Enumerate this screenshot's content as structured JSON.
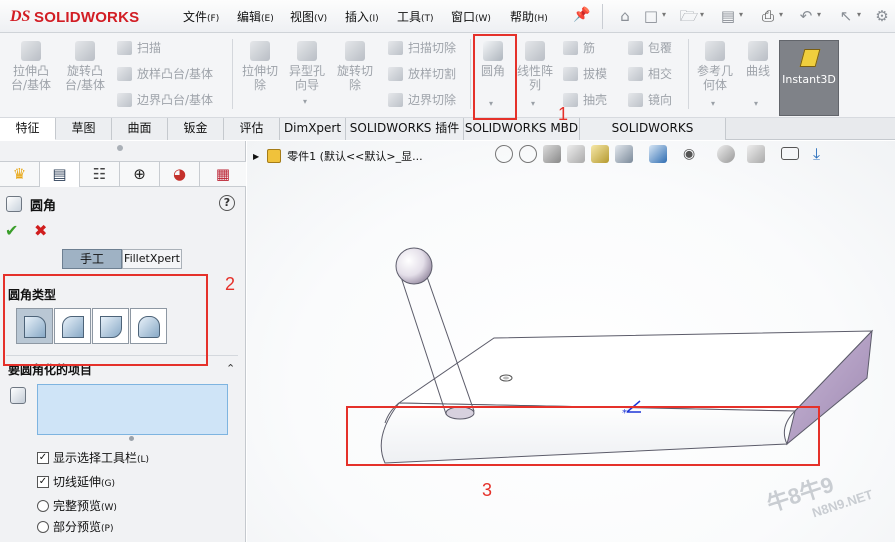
{
  "app": {
    "brand": "SOLIDWORKS",
    "logo_mark": "DS"
  },
  "menu": [
    {
      "label": "文件",
      "key": "(F)"
    },
    {
      "label": "编辑",
      "key": "(E)"
    },
    {
      "label": "视图",
      "key": "(V)"
    },
    {
      "label": "插入",
      "key": "(I)"
    },
    {
      "label": "工具",
      "key": "(T)"
    },
    {
      "label": "窗口",
      "key": "(W)"
    },
    {
      "label": "帮助",
      "key": "(H)"
    }
  ],
  "ribbon": {
    "extrude_boss": "拉伸凸\n台/基体",
    "revolve_boss": "旋转凸\n台/基体",
    "sweep": "扫描",
    "loft_boss": "放样凸台/基体",
    "boundary_boss": "边界凸台/基体",
    "extrude_cut": "拉伸切\n除",
    "hole_wizard": "异型孔\n向导",
    "revolve_cut": "旋转切\n除",
    "swept_cut": "扫描切除",
    "lofted_cut": "放样切割",
    "boundary_cut": "边界切除",
    "fillet": "圆角",
    "linear_pattern": "线性阵\n列",
    "rib": "筋",
    "draft": "拔模",
    "shell": "抽壳",
    "wrap": "包覆",
    "intersect": "相交",
    "mirror": "镜向",
    "ref_geometry": "参考几\n何体",
    "curves": "曲线",
    "instant3d": "Instant3D"
  },
  "tabs": [
    "特征",
    "草图",
    "曲面",
    "钣金",
    "评估",
    "DimXpert",
    "SOLIDWORKS 插件",
    "SOLIDWORKS MBD",
    "SOLIDWORKS Inspection"
  ],
  "property_manager": {
    "title": "圆角",
    "help": "?",
    "mode_manual": "手工",
    "mode_xpert": "FilletXpert",
    "fillet_type_group": "圆角类型",
    "items_group": "要圆角化的项目",
    "options": [
      {
        "label": "显示选择工具栏",
        "key": "(L)",
        "type": "checkbox",
        "checked": true
      },
      {
        "label": "切线延伸",
        "key": "(G)",
        "type": "checkbox",
        "checked": true
      },
      {
        "label": "完整预览",
        "key": "(W)",
        "type": "radio",
        "checked": false
      },
      {
        "label": "部分预览",
        "key": "(P)",
        "type": "radio",
        "checked": false
      }
    ]
  },
  "graphics": {
    "tree_path": "零件1  (默认<<默认>_显..."
  },
  "annotations": [
    "1",
    "2",
    "3"
  ],
  "watermark": {
    "line1": "牛8牛9",
    "line2": "N8N9.NET"
  },
  "colors": {
    "accent_red": "#e5312a",
    "brand_red": "#d21d24",
    "selection_blue": "#cfe4f7"
  }
}
